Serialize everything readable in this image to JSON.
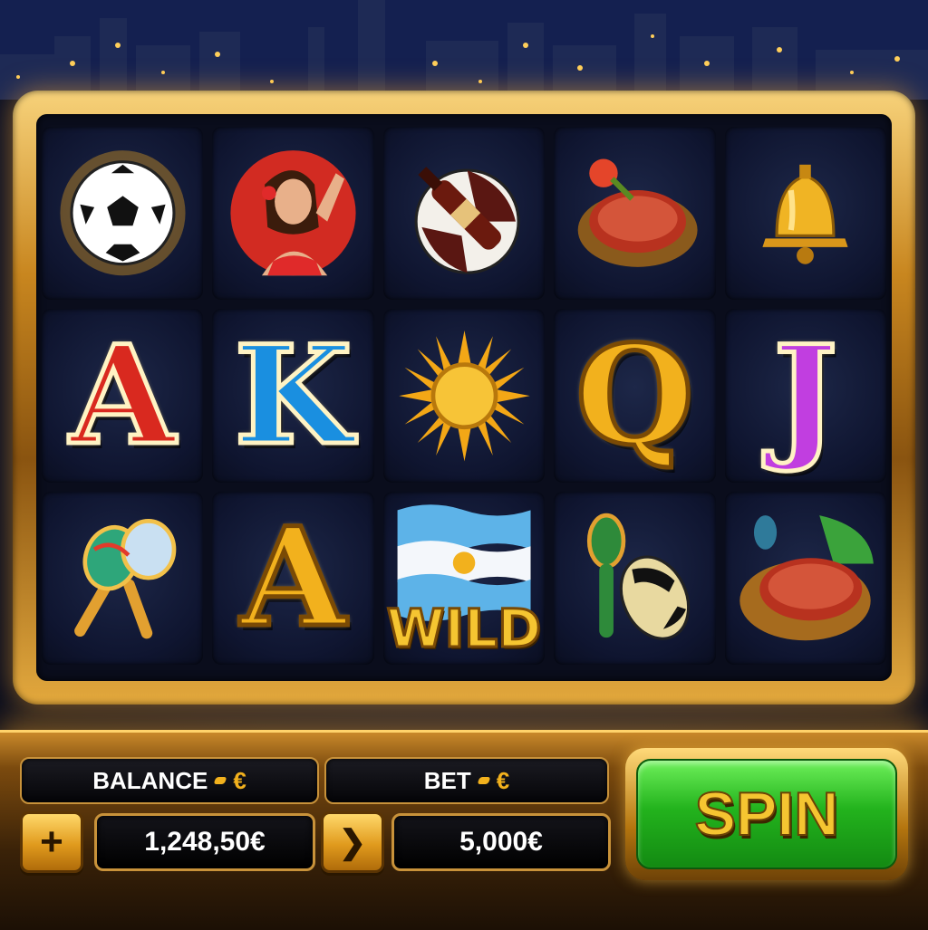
{
  "reels": {
    "row1": [
      "soccer-ball",
      "flamenco-dancer",
      "ball-and-bottle",
      "grilled-steak",
      "golden-bell"
    ],
    "row2": [
      "letter-a-red",
      "letter-k-blue",
      "golden-sun",
      "letter-q-gold",
      "letter-j-pink"
    ],
    "row3": [
      "maracas",
      "letter-a-gold",
      "wild-flag",
      "maraca-and-ball",
      "steak-platter"
    ],
    "letters": {
      "a_red": "A",
      "k_blue": "K",
      "q_gold": "Q",
      "j_pink": "J",
      "a_gold": "A"
    },
    "wild_label": "WILD"
  },
  "panel": {
    "balance_label": "BALANCE",
    "balance_currency": "€",
    "balance_value": "1,248,50€",
    "bet_label": "BET",
    "bet_currency": "€",
    "bet_value": "5,000€",
    "plus_symbol": "+",
    "next_symbol": "❯",
    "spin_label": "SPIN"
  },
  "colors": {
    "frame_gold": "#e3a93e",
    "spin_green": "#23b31d",
    "accent_gold": "#f2b11d"
  }
}
